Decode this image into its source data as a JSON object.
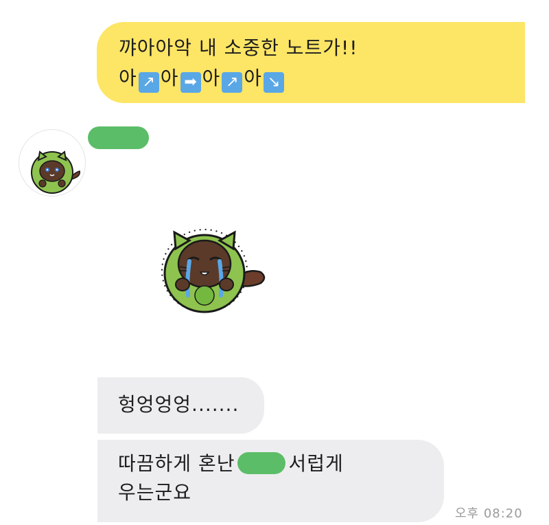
{
  "messages": {
    "sent": {
      "line1": "꺄아아악 내 소중한 노트가!!",
      "line2": {
        "seg1": "아",
        "icon1": "↗",
        "seg2": "아",
        "icon2": "➡",
        "seg3": "아",
        "icon3": "↗",
        "seg4": "아",
        "icon4": "↘"
      }
    },
    "received": {
      "bubble1": "헝엉엉엉.......",
      "bubble2": {
        "part1": "따끔하게 혼난",
        "part2": "서럽게",
        "line2": "우는군요"
      }
    }
  },
  "timestamp": "오후 08:20",
  "icons": {
    "avatar": "raccoon-avatar-icon",
    "sticker": "crying-raccoon-sticker-icon",
    "arrows": [
      "arrow-upper-right-icon",
      "arrow-right-icon",
      "arrow-lower-right-icon"
    ]
  },
  "colors": {
    "sent_bubble": "#fde566",
    "received_bubble": "#ededef",
    "censor": "#5cbd68",
    "emoji_blue": "#5aa7e6"
  }
}
